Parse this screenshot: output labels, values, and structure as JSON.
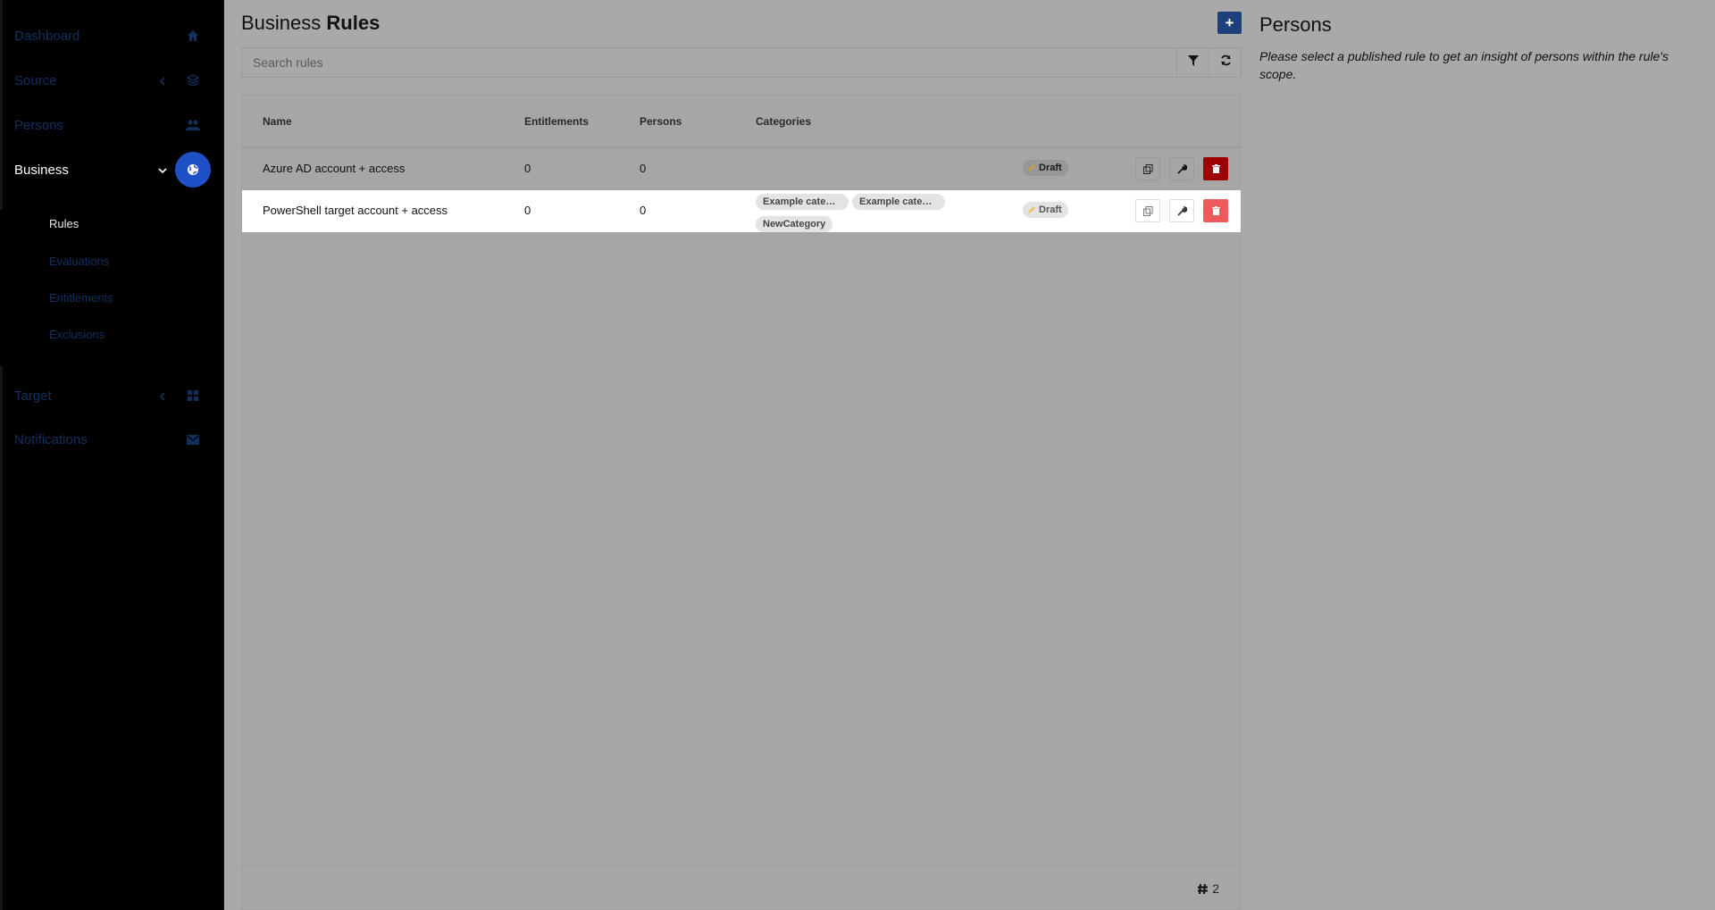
{
  "sidebar": {
    "items": [
      {
        "label": "Dashboard"
      },
      {
        "label": "Source"
      },
      {
        "label": "Persons"
      },
      {
        "label": "Business"
      },
      {
        "label": "Target"
      },
      {
        "label": "Notifications"
      }
    ],
    "business_sub": [
      {
        "label": "Rules"
      },
      {
        "label": "Evaluations"
      },
      {
        "label": "Entitlements"
      },
      {
        "label": "Exclusions"
      }
    ]
  },
  "header": {
    "title_prefix": "Business",
    "title_bold": "Rules",
    "add_label": "+"
  },
  "search": {
    "placeholder": "Search rules",
    "value": ""
  },
  "table": {
    "columns": [
      "Name",
      "Entitlements",
      "Persons",
      "Categories"
    ],
    "rows": [
      {
        "name": "Azure AD account + access",
        "entitlements": "0",
        "persons": "0",
        "categories": [],
        "status": "Draft"
      },
      {
        "name": "PowerShell target account + access",
        "entitlements": "0",
        "persons": "0",
        "categories": [
          "Example categor…",
          "Example categor…",
          "NewCategory"
        ],
        "status": "Draft"
      }
    ],
    "count": "2"
  },
  "persons_panel": {
    "title": "Persons",
    "message": "Please select a published rule to get an insight of persons within the rule's scope."
  },
  "colors": {
    "accent": "#1f4fc4",
    "add_button": "#1d3f7a",
    "delete": "#9e0000",
    "delete_selected": "#ef5a5a"
  },
  "icons": [
    "home-icon",
    "database-icon",
    "users-icon",
    "globe-icon",
    "grid-icon",
    "envelope-icon",
    "filter-icon",
    "refresh-icon",
    "copy-icon",
    "wrench-icon",
    "trash-icon",
    "pencil-icon",
    "hash-icon",
    "chevron-left-icon",
    "chevron-down-icon"
  ]
}
